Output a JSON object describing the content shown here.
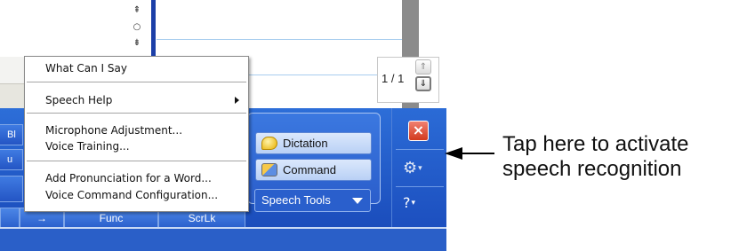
{
  "document": {
    "split_widget_glyphs": [
      "⇞",
      "○",
      "⇟"
    ],
    "page_indicator": "1 / 1",
    "page_up_glyph": "⇑",
    "page_down_glyph": "⇓"
  },
  "context_menu": {
    "items": [
      "What Can I Say",
      "Speech Help",
      "Microphone Adjustment...",
      "Voice Training...",
      "Add Pronunciation for a Word...",
      "Voice Command Configuration..."
    ]
  },
  "input_panel": {
    "left_key_labels": [
      "Bl",
      "u",
      ""
    ],
    "bottom_keys": [
      "",
      "→",
      "Func",
      "ScrLk"
    ],
    "speech": {
      "dictation_label": "Dictation",
      "command_label": "Command",
      "tools_label": "Speech Tools"
    },
    "close_glyph": "×",
    "gear_glyph": "⚙",
    "help_glyph": "?"
  },
  "callout": {
    "line1": "Tap here to activate",
    "line2": "speech recognition"
  }
}
